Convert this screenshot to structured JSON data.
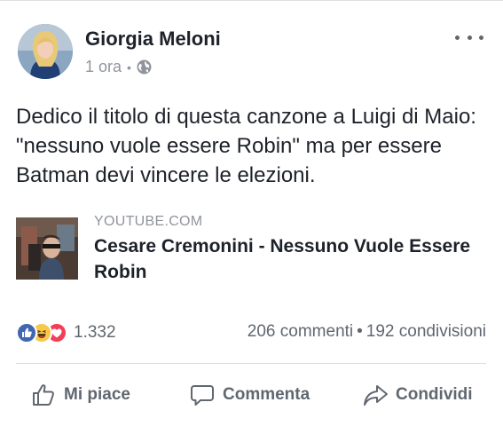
{
  "post": {
    "author": "Giorgia Meloni",
    "time": "1 ora",
    "separator": "•",
    "privacy_icon": "globe-icon",
    "more_icon": "more-options-icon",
    "text": "Dedico il titolo di questa canzone a Luigi di Maio: \"nessuno vuole essere Robin\" ma per essere Batman devi vincere le elezioni."
  },
  "link_preview": {
    "domain": "YOUTUBE.COM",
    "title": "Cesare Cremonini - Nessuno Vuole Essere Robin"
  },
  "stats": {
    "reactions": [
      "like-icon",
      "haha-icon",
      "love-icon"
    ],
    "reaction_count": "1.332",
    "comments": "206 commenti",
    "dot": "•",
    "shares": "192 condivisioni"
  },
  "actions": {
    "like": "Mi piace",
    "comment": "Commenta",
    "share": "Condividi"
  },
  "colors": {
    "text": "#1d2129",
    "secondary": "#90949c",
    "action": "#606770",
    "like_blue": "#4267b2",
    "love_red": "#f33e58",
    "haha_yellow": "#f7c94b"
  }
}
